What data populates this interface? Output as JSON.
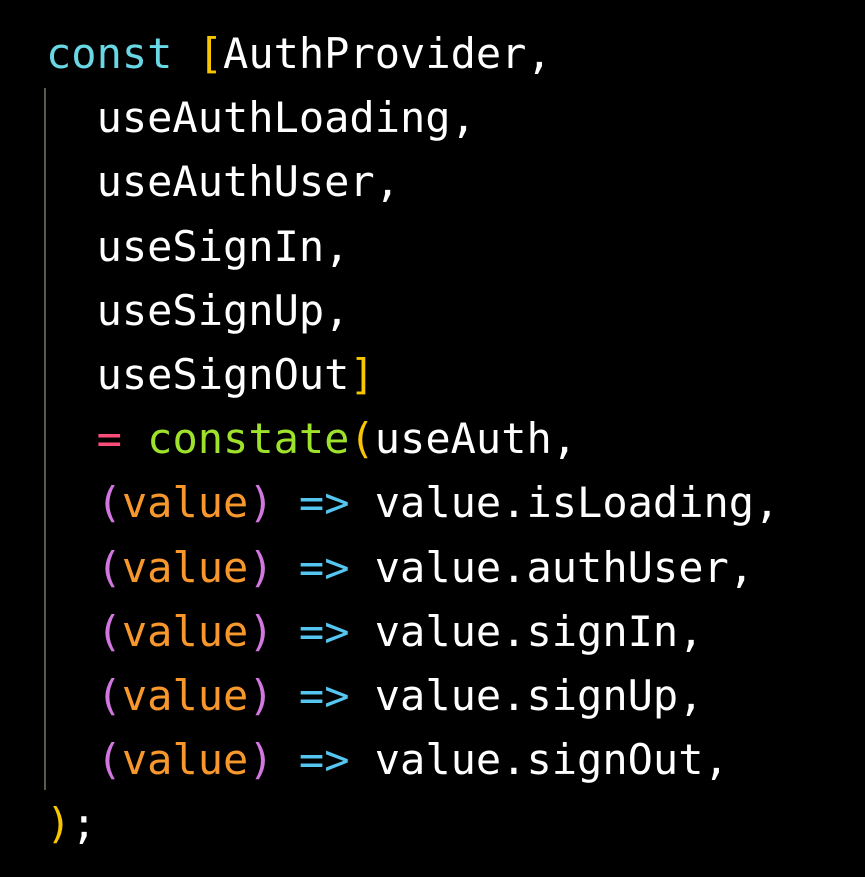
{
  "colors": {
    "background": "#000000",
    "keyword": "#6ad7e5",
    "bracket": "#f7c600",
    "identifier": "#ffffff",
    "operator": "#ff4d7a",
    "function": "#9ee22b",
    "paren": "#d277e0",
    "param": "#f8982c",
    "arrow": "#54c6f0",
    "indent_guide": "#5a5a4a"
  },
  "lines": [
    [
      {
        "text": "const",
        "color": "#6ad7e5"
      },
      {
        "text": " ",
        "color": "#ffffff"
      },
      {
        "text": "[",
        "color": "#f7c600"
      },
      {
        "text": "AuthProvider,",
        "color": "#ffffff"
      }
    ],
    [
      {
        "text": "  useAuthLoading,",
        "color": "#ffffff"
      }
    ],
    [
      {
        "text": "  useAuthUser,",
        "color": "#ffffff"
      }
    ],
    [
      {
        "text": "  useSignIn,",
        "color": "#ffffff"
      }
    ],
    [
      {
        "text": "  useSignUp,",
        "color": "#ffffff"
      }
    ],
    [
      {
        "text": "  useSignOut",
        "color": "#ffffff"
      },
      {
        "text": "]",
        "color": "#f7c600"
      }
    ],
    [
      {
        "text": "  ",
        "color": "#ffffff"
      },
      {
        "text": "=",
        "color": "#ff4d7a"
      },
      {
        "text": " ",
        "color": "#ffffff"
      },
      {
        "text": "constate",
        "color": "#9ee22b"
      },
      {
        "text": "(",
        "color": "#f7c600"
      },
      {
        "text": "useAuth,",
        "color": "#ffffff"
      }
    ],
    [
      {
        "text": "  ",
        "color": "#ffffff"
      },
      {
        "text": "(",
        "color": "#d277e0"
      },
      {
        "text": "value",
        "color": "#f8982c"
      },
      {
        "text": ")",
        "color": "#d277e0"
      },
      {
        "text": " ",
        "color": "#ffffff"
      },
      {
        "text": "=>",
        "color": "#54c6f0"
      },
      {
        "text": " value.isLoading,",
        "color": "#ffffff"
      }
    ],
    [
      {
        "text": "  ",
        "color": "#ffffff"
      },
      {
        "text": "(",
        "color": "#d277e0"
      },
      {
        "text": "value",
        "color": "#f8982c"
      },
      {
        "text": ")",
        "color": "#d277e0"
      },
      {
        "text": " ",
        "color": "#ffffff"
      },
      {
        "text": "=>",
        "color": "#54c6f0"
      },
      {
        "text": " value.authUser,",
        "color": "#ffffff"
      }
    ],
    [
      {
        "text": "  ",
        "color": "#ffffff"
      },
      {
        "text": "(",
        "color": "#d277e0"
      },
      {
        "text": "value",
        "color": "#f8982c"
      },
      {
        "text": ")",
        "color": "#d277e0"
      },
      {
        "text": " ",
        "color": "#ffffff"
      },
      {
        "text": "=>",
        "color": "#54c6f0"
      },
      {
        "text": " value.signIn,",
        "color": "#ffffff"
      }
    ],
    [
      {
        "text": "  ",
        "color": "#ffffff"
      },
      {
        "text": "(",
        "color": "#d277e0"
      },
      {
        "text": "value",
        "color": "#f8982c"
      },
      {
        "text": ")",
        "color": "#d277e0"
      },
      {
        "text": " ",
        "color": "#ffffff"
      },
      {
        "text": "=>",
        "color": "#54c6f0"
      },
      {
        "text": " value.signUp,",
        "color": "#ffffff"
      }
    ],
    [
      {
        "text": "  ",
        "color": "#ffffff"
      },
      {
        "text": "(",
        "color": "#d277e0"
      },
      {
        "text": "value",
        "color": "#f8982c"
      },
      {
        "text": ")",
        "color": "#d277e0"
      },
      {
        "text": " ",
        "color": "#ffffff"
      },
      {
        "text": "=>",
        "color": "#54c6f0"
      },
      {
        "text": " value.signOut,",
        "color": "#ffffff"
      }
    ],
    [
      {
        "text": ")",
        "color": "#f7c600"
      },
      {
        "text": ";",
        "color": "#ffffff"
      }
    ]
  ]
}
